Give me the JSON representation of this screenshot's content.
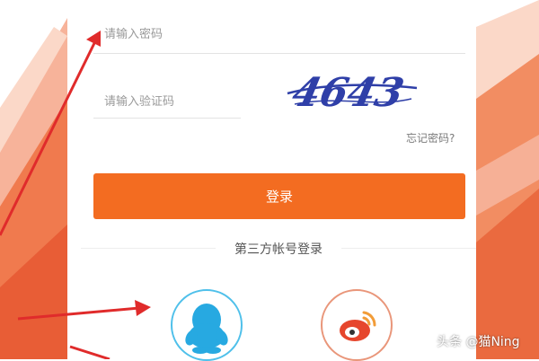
{
  "password_field": {
    "placeholder": "请输入密码"
  },
  "captcha_field": {
    "placeholder": "请输入验证码"
  },
  "captcha_image": {
    "code": "4643"
  },
  "forgot_password": {
    "label": "忘记密码?"
  },
  "login_button": {
    "label": "登录"
  },
  "third_party": {
    "label": "第三方帐号登录"
  },
  "social_logins": [
    {
      "name": "qq-icon"
    },
    {
      "name": "weibo-icon"
    }
  ],
  "watermark": {
    "text": "头条 @猫Ning"
  },
  "colors": {
    "accent": "#f36c21",
    "qq_blue": "#4fc0ea",
    "weibo_orange": "#e9967a",
    "annotation_red": "#e02b2b"
  }
}
